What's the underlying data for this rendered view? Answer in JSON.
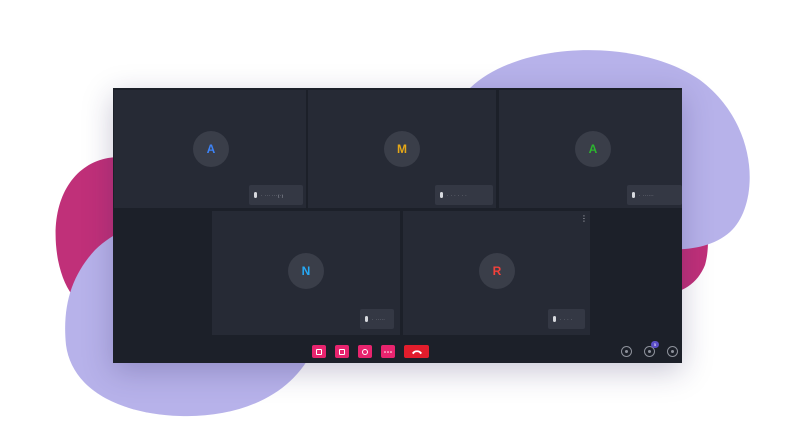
{
  "colors": {
    "blob_pink": "#c03079",
    "blob_lavender": "#b7b2ea",
    "window_bg": "#1c2029",
    "tile_bg": "#262a35",
    "control_accent": "#e8246e",
    "end_call": "#e21d2c",
    "badge": "#5b4dc8"
  },
  "participants": [
    {
      "initial": "A",
      "name": "· ··· ···(·)",
      "initial_color": "#3d83f6"
    },
    {
      "initial": "M",
      "name": "· · · · · ·",
      "initial_color": "#e6a817"
    },
    {
      "initial": "A",
      "name": "· ······",
      "initial_color": "#2cb52f"
    },
    {
      "initial": "N",
      "name": "· ·····",
      "initial_color": "#26a9f5"
    },
    {
      "initial": "R",
      "name": "· · · ·",
      "initial_color": "#f2413b"
    }
  ],
  "tile_menu_icon": "⋮",
  "controls": {
    "icons": [
      "document-icon",
      "chat-icon",
      "screen-share-icon",
      "more-icon"
    ],
    "end_call_icon": "phone-hangup-icon",
    "right_icons": [
      "info-icon",
      "participants-icon",
      "settings-icon"
    ],
    "participants_badge": "5"
  }
}
